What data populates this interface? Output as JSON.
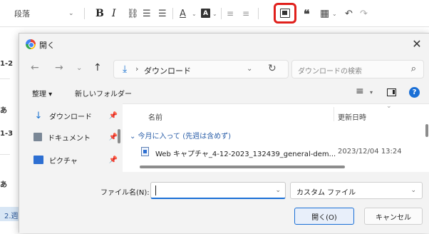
{
  "toolbar": {
    "style_label": "段落",
    "chevron": "⌄",
    "bold": "B",
    "italic": "I",
    "link_icon": "⛓",
    "bullet_icon": "☰",
    "number_icon": "☰",
    "font_color_icon": "A",
    "bg_color_icon": "A",
    "indent_icon": "≡",
    "outdent_icon": "≡",
    "quote_icon": "❝",
    "table_icon": "▦",
    "undo_icon": "↶",
    "redo_icon": "↷",
    "highlight_color": "#e0201c"
  },
  "editor_edge": {
    "frag1": "1-2",
    "frag2": "あ",
    "frag3": "1-3",
    "frag4": "あ",
    "frag5": "2.週"
  },
  "dialog": {
    "title": "開く",
    "close_icon": "✕",
    "nav": {
      "back_icon": "←",
      "forward_icon": "→",
      "recent_icon": "⌄",
      "up_icon": "↑",
      "path_separator": "›",
      "path_folder": "ダウンロード",
      "path_chevron": "⌄",
      "refresh_icon": "↻",
      "search_placeholder": "ダウンロードの検索",
      "search_icon": "⌕"
    },
    "commands": {
      "organize": "整理 ▾",
      "new_folder": "新しいフォルダー",
      "view_icon": "≡",
      "view_chevron": "▾",
      "help_icon": "?"
    },
    "nav_pane": [
      {
        "icon": "↓",
        "label": "ダウンロード",
        "pin": "📌"
      },
      {
        "icon": "",
        "label": "ドキュメント",
        "pin": "📌"
      },
      {
        "icon": "",
        "label": "ピクチャ",
        "pin": "📌"
      }
    ],
    "file_list": {
      "col_name": "名前",
      "col_date": "更新日時",
      "sort_chevron": "⌄",
      "group": "⌄ 今月に入って (先週は含めず)",
      "files": [
        {
          "name": "Web キャプチャ_4-12-2023_132439_general-dem...",
          "date": "2023/12/04 13:24"
        }
      ]
    },
    "bottom": {
      "filename_label": "ファイル名(N):",
      "filename_value": "",
      "filename_chevron": "⌄",
      "filetype": "カスタム ファイル",
      "filetype_chevron": "⌄",
      "open_button": "開く(O)",
      "cancel_button": "キャンセル"
    }
  }
}
